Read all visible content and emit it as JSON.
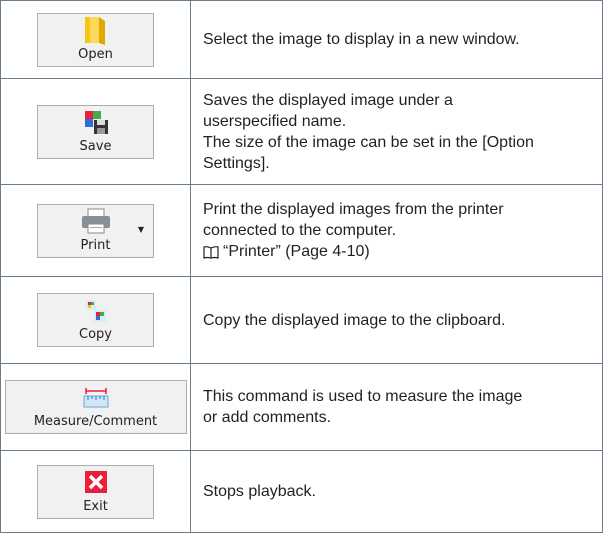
{
  "rows": [
    {
      "button_label": "Open",
      "icon": "folder-icon",
      "lines": [
        "Select the image to display in a new window."
      ]
    },
    {
      "button_label": "Save",
      "icon": "save-icon",
      "lines": [
        "Saves the displayed image under a",
        "userspecified name.",
        "The size of the image can be set in the [Option",
        "Settings]."
      ]
    },
    {
      "button_label": "Print",
      "icon": "printer-icon",
      "lines": [
        "Print the displayed images from the printer",
        "connected to the computer."
      ],
      "reference": "“Printer” (Page 4-10)"
    },
    {
      "button_label": "Copy",
      "icon": "copy-icon",
      "lines": [
        "Copy the displayed image to the clipboard."
      ]
    },
    {
      "button_label": "Measure/Comment",
      "icon": "ruler-icon",
      "lines": [
        "This command is used to measure the image",
        "or add comments."
      ]
    },
    {
      "button_label": "Exit",
      "icon": "exit-icon",
      "lines": [
        "Stops playback."
      ]
    }
  ],
  "colors": {
    "border": "#6b7c8f",
    "exit_red": "#e8203a",
    "folder_yellow": "#f5c518"
  }
}
